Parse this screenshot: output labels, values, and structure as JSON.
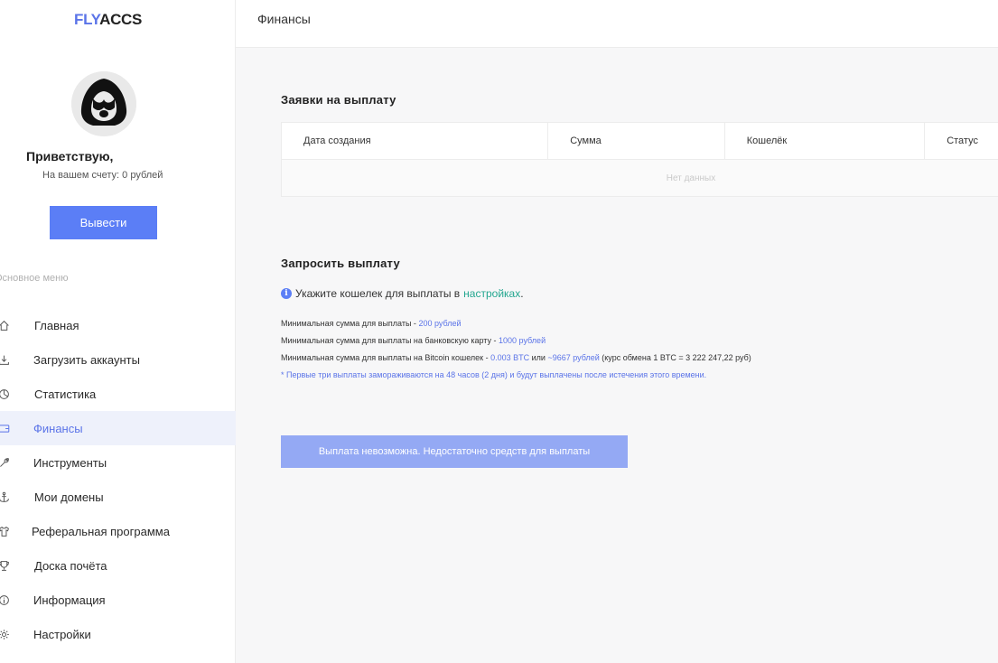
{
  "brand": {
    "part1": "FLY",
    "part2": "ACCS"
  },
  "user": {
    "greeting": "Приветствую,",
    "balance": "На вашем счету: 0 рублей"
  },
  "sidebar": {
    "withdraw_label": "Вывести",
    "menu_title": "Основное меню",
    "items": [
      {
        "label": "Главная",
        "icon": "home-icon"
      },
      {
        "label": "Загрузить аккаунты",
        "icon": "upload-icon"
      },
      {
        "label": "Статистика",
        "icon": "chart-icon"
      },
      {
        "label": "Финансы",
        "icon": "wallet-icon"
      },
      {
        "label": "Инструменты",
        "icon": "wrench-icon"
      },
      {
        "label": "Мои домены",
        "icon": "anchor-icon"
      },
      {
        "label": "Реферальная программа",
        "icon": "shirt-icon"
      },
      {
        "label": "Доска почёта",
        "icon": "trophy-icon"
      },
      {
        "label": "Информация",
        "icon": "info-icon"
      },
      {
        "label": "Настройки",
        "icon": "gear-icon"
      }
    ],
    "active_index": 3
  },
  "header": {
    "title": "Финансы"
  },
  "payouts_table": {
    "title": "Заявки на выплату",
    "columns": [
      "Дата создания",
      "Сумма",
      "Кошелёк",
      "Статус"
    ],
    "empty_text": "Нет данных"
  },
  "request": {
    "title": "Запросить выплату",
    "notice_text": "Укажите кошелек для выплаты в",
    "notice_link": "настройках",
    "notice_end": ".",
    "rules": [
      {
        "text": "Минимальная сумма для выплаты - ",
        "highlight": "200 рублей"
      },
      {
        "text": "Минимальная сумма для выплаты на банковскую карту - ",
        "highlight": "1000 рублей"
      }
    ],
    "btc_rule": {
      "text": "Минимальная сумма для выплаты на Bitcoin кошелек - ",
      "btc": "0.003 BTC",
      "or": " или ",
      "rub": "~9667 рублей",
      "rate": " (курс обмена 1 BTC = 3 222 247,22 руб)"
    },
    "note": "* Первые три выплаты замораживаются на 48 часов (2 дня) и будут выплачены после истечения этого времени.",
    "button_label": "Выплата невозможна. Недостаточно средств для выплаты"
  },
  "colors": {
    "accent": "#5b7ef6",
    "link_green": "#23a68f",
    "disabled_button": "#94a9f4"
  }
}
